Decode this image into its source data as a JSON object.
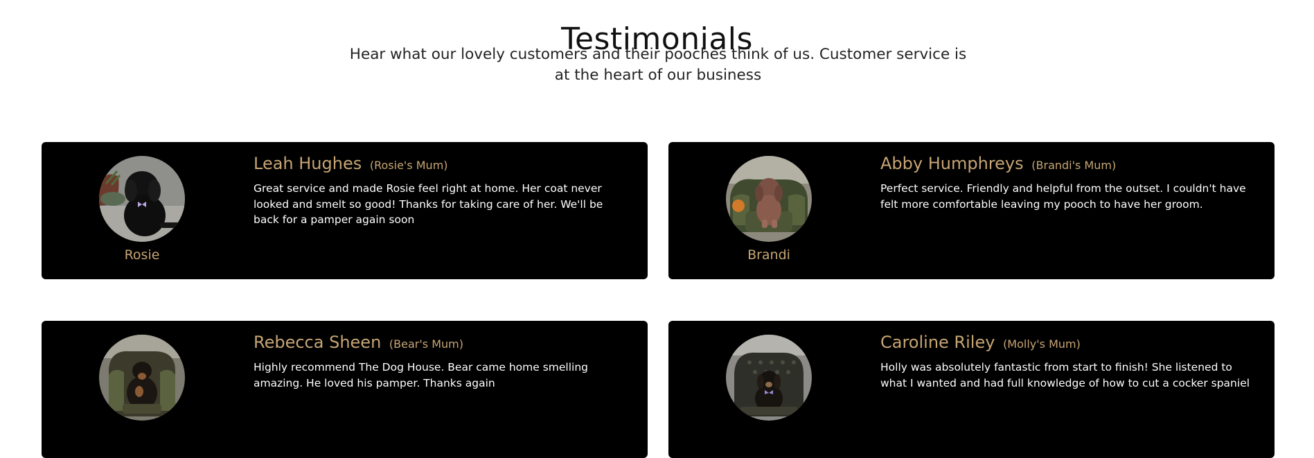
{
  "section": {
    "title": "Testimonials",
    "subtitle": "Hear what our lovely customers and their pooches think of us. Customer service is at the heart of our business"
  },
  "colors": {
    "card_background": "#000000",
    "accent_gold": "#c7a574",
    "quote_text": "#ffffff"
  },
  "testimonials": [
    {
      "author": "Leah Hughes",
      "relation": "(Rosie's Mum)",
      "quote": "Great service and made Rosie feel right at home. Her coat never looked and smelt so good! Thanks for taking care of her. We'll be back for a pamper again soon",
      "pet_name": "Rosie",
      "photo": "dog-photo-icon"
    },
    {
      "author": "Abby Humphreys",
      "relation": "(Brandi's Mum)",
      "quote": "Perfect service. Friendly and helpful from the outset. I couldn't have felt more comfortable leaving my pooch to have her groom.",
      "pet_name": "Brandi",
      "photo": "dog-photo-icon"
    },
    {
      "author": "Rebecca Sheen",
      "relation": "(Bear's Mum)",
      "quote": "Highly recommend The Dog House. Bear came home smelling amazing. He loved his pamper. Thanks again",
      "pet_name": "",
      "photo": "dog-photo-icon"
    },
    {
      "author": "Caroline Riley",
      "relation": "(Molly's Mum)",
      "quote": "Holly was absolutely fantastic from start to finish! She listened to what I wanted and had full knowledge of how to cut a cocker spaniel",
      "pet_name": "",
      "photo": "dog-photo-icon"
    }
  ]
}
